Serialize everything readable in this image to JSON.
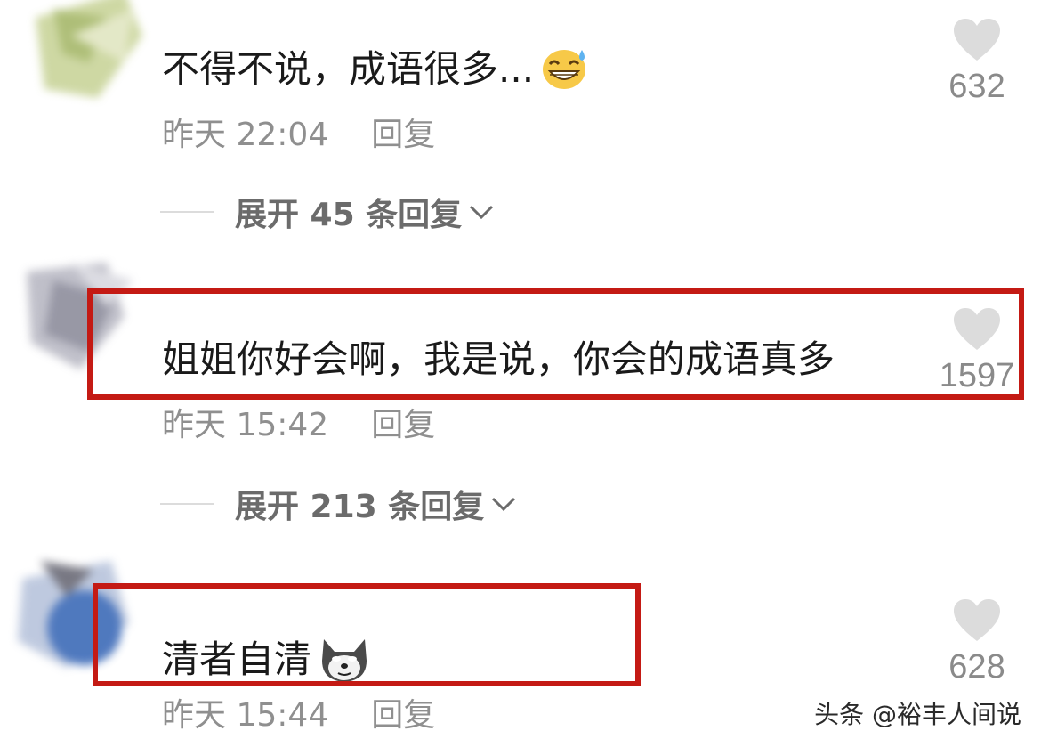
{
  "comments": [
    {
      "text": "不得不说，成语很多...",
      "emoji": "grinning-sweat-emoji",
      "time": "昨天 22:04",
      "reply_label": "回复",
      "likes": "632",
      "expand_label": "展开 45 条回复"
    },
    {
      "text": "姐姐你好会啊，我是说，你会的成语真多",
      "time": "昨天 15:42",
      "reply_label": "回复",
      "likes": "1597",
      "expand_label": "展开 213 条回复",
      "highlighted": true
    },
    {
      "text": "清者自清",
      "emoji": "doge-emoji",
      "time": "昨天 15:44",
      "reply_label": "回复",
      "likes": "628",
      "highlighted": true
    }
  ],
  "watermark": "头条 @裕丰人间说",
  "colors": {
    "highlight": "#c41a14",
    "meta_text": "#8f8f8f",
    "heart": "#dcdcdc"
  }
}
